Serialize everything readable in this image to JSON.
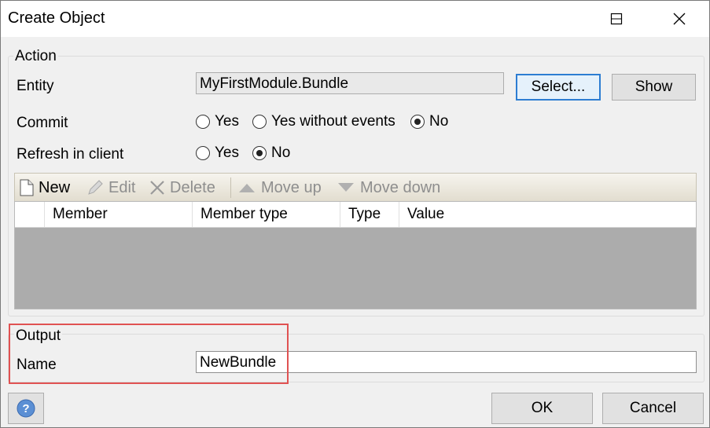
{
  "window": {
    "title": "Create Object",
    "minimize_icon": "minimize-icon",
    "maximize_icon": "maximize-icon",
    "close_icon": "close-icon"
  },
  "action": {
    "group_label": "Action",
    "entity_label": "Entity",
    "entity_value": "MyFirstModule.Bundle",
    "select_button": "Select...",
    "show_button": "Show",
    "commit_label": "Commit",
    "commit_options": [
      {
        "label": "Yes",
        "selected": false
      },
      {
        "label": "Yes without events",
        "selected": false
      },
      {
        "label": "No",
        "selected": true
      }
    ],
    "refresh_label": "Refresh in client",
    "refresh_options": [
      {
        "label": "Yes",
        "selected": false
      },
      {
        "label": "No",
        "selected": true
      }
    ],
    "toolbar": {
      "new_label": "New",
      "edit_label": "Edit",
      "delete_label": "Delete",
      "move_up_label": "Move up",
      "move_down_label": "Move down"
    },
    "members_table": {
      "columns": [
        "Member",
        "Member type",
        "Type",
        "Value"
      ],
      "rows": []
    }
  },
  "output": {
    "group_label": "Output",
    "name_label": "Name",
    "name_value": "NewBundle"
  },
  "footer": {
    "help_icon": "help-icon",
    "ok_button": "OK",
    "cancel_button": "Cancel"
  },
  "colors": {
    "highlight_border": "#e05252",
    "focus_border": "#2d7dd2",
    "grid_background": "#acacac"
  }
}
